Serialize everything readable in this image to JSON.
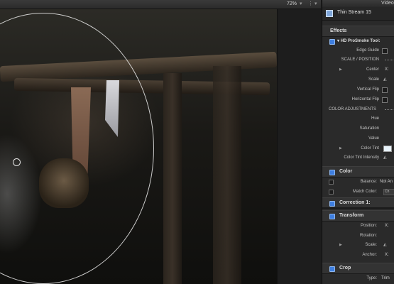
{
  "viewer": {
    "zoom": "72%",
    "zoom_caret": "▾",
    "view_icon": "⋮",
    "view_caret": "▾"
  },
  "inspector": {
    "top_label": "Video",
    "clip_name": "Thin Stream 15",
    "effects_label": "Effects",
    "effect_name": "HD ProSmoke Tool:",
    "rows": {
      "edge_guide": "Edge Guide",
      "scale_position": "SCALE / POSITION",
      "center": "Center",
      "center_val": "X:",
      "scale": "Scale",
      "vertical_flip": "Vertical Flip",
      "horizontal_flip": "Horizontal Flip",
      "color_adjustments": "COLOR ADJUSTMENTS",
      "hue": "Hue",
      "saturation": "Saturation",
      "value": "Value",
      "color_tint": "Color Tint",
      "color_tint_intensity": "Color Tint Intensity"
    },
    "color_section": {
      "title": "Color",
      "balance_label": "Balance:",
      "balance_value": "Not An",
      "match_color_label": "Match Color:",
      "match_color_value": "Ch"
    },
    "correction_section": {
      "title": "Correction 1:"
    },
    "transform_section": {
      "title": "Transform",
      "position": "Position:",
      "position_val": "X:",
      "rotation": "Rotation:",
      "scale": "Scale:",
      "anchor": "Anchor:",
      "anchor_val": "X:"
    },
    "crop_section": {
      "title": "Crop",
      "type_label": "Type:",
      "type_value": "Trim"
    },
    "colors": {
      "accent": "#3f7fe0",
      "tint_swatch": "#e8f3fb"
    }
  }
}
